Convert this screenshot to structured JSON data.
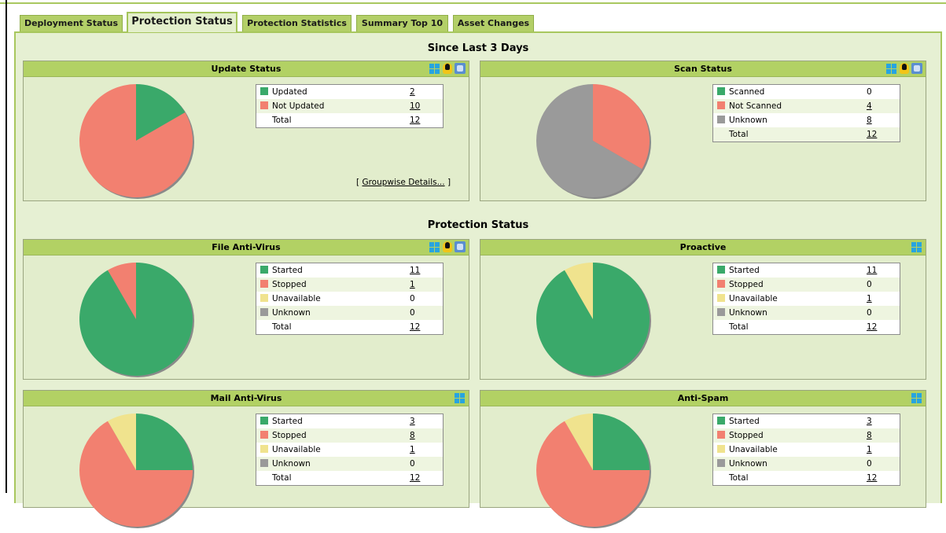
{
  "tabs": [
    {
      "label": "Deployment Status"
    },
    {
      "label": "Protection Status"
    },
    {
      "label": "Protection Statistics"
    },
    {
      "label": "Summary Top 10"
    },
    {
      "label": "Asset Changes"
    }
  ],
  "sections": {
    "since": "Since Last 3 Days",
    "protection": "Protection Status"
  },
  "colors": {
    "green": "#3aa96a",
    "red": "#f28070",
    "yellow": "#f0e38e",
    "gray": "#9a9a9a"
  },
  "panels": {
    "update": {
      "title": "Update Status",
      "icons": [
        "windows-icon",
        "linux-icon",
        "mac-icon"
      ],
      "rows": [
        {
          "label": "Updated",
          "value": "2",
          "link": true,
          "color": "green"
        },
        {
          "label": "Not Updated",
          "value": "10",
          "link": true,
          "color": "red"
        }
      ],
      "total_label": "Total",
      "total_value": "12",
      "details": "Groupwise Details...",
      "details_open": "[",
      "details_close": "]"
    },
    "scan": {
      "title": "Scan Status",
      "icons": [
        "windows-icon",
        "linux-icon",
        "mac-icon"
      ],
      "rows": [
        {
          "label": "Scanned",
          "value": "0",
          "link": false,
          "color": "green"
        },
        {
          "label": "Not Scanned",
          "value": "4",
          "link": true,
          "color": "red"
        },
        {
          "label": "Unknown",
          "value": "8",
          "link": true,
          "color": "gray"
        }
      ],
      "total_label": "Total",
      "total_value": "12"
    },
    "fav": {
      "title": "File Anti-Virus",
      "icons": [
        "windows-icon",
        "linux-icon",
        "mac-icon"
      ],
      "rows": [
        {
          "label": "Started",
          "value": "11",
          "link": true,
          "color": "green"
        },
        {
          "label": "Stopped",
          "value": "1",
          "link": true,
          "color": "red"
        },
        {
          "label": "Unavailable",
          "value": "0",
          "link": false,
          "color": "yellow"
        },
        {
          "label": "Unknown",
          "value": "0",
          "link": false,
          "color": "gray"
        }
      ],
      "total_label": "Total",
      "total_value": "12"
    },
    "proactive": {
      "title": "Proactive",
      "icons": [
        "windows-icon"
      ],
      "rows": [
        {
          "label": "Started",
          "value": "11",
          "link": true,
          "color": "green"
        },
        {
          "label": "Stopped",
          "value": "0",
          "link": false,
          "color": "red"
        },
        {
          "label": "Unavailable",
          "value": "1",
          "link": true,
          "color": "yellow"
        },
        {
          "label": "Unknown",
          "value": "0",
          "link": false,
          "color": "gray"
        }
      ],
      "total_label": "Total",
      "total_value": "12"
    },
    "mail": {
      "title": "Mail Anti-Virus",
      "icons": [
        "windows-icon"
      ],
      "rows": [
        {
          "label": "Started",
          "value": "3",
          "link": true,
          "color": "green"
        },
        {
          "label": "Stopped",
          "value": "8",
          "link": true,
          "color": "red"
        },
        {
          "label": "Unavailable",
          "value": "1",
          "link": true,
          "color": "yellow"
        },
        {
          "label": "Unknown",
          "value": "0",
          "link": false,
          "color": "gray"
        }
      ],
      "total_label": "Total",
      "total_value": "12"
    },
    "spam": {
      "title": "Anti-Spam",
      "icons": [
        "windows-icon"
      ],
      "rows": [
        {
          "label": "Started",
          "value": "3",
          "link": true,
          "color": "green"
        },
        {
          "label": "Stopped",
          "value": "8",
          "link": true,
          "color": "red"
        },
        {
          "label": "Unavailable",
          "value": "1",
          "link": true,
          "color": "yellow"
        },
        {
          "label": "Unknown",
          "value": "0",
          "link": false,
          "color": "gray"
        }
      ],
      "total_label": "Total",
      "total_value": "12"
    }
  },
  "chart_data": [
    {
      "type": "pie",
      "title": "Update Status",
      "labels": [
        "Updated",
        "Not Updated"
      ],
      "values": [
        2,
        10
      ]
    },
    {
      "type": "pie",
      "title": "Scan Status",
      "labels": [
        "Scanned",
        "Not Scanned",
        "Unknown"
      ],
      "values": [
        0,
        4,
        8
      ]
    },
    {
      "type": "pie",
      "title": "File Anti-Virus",
      "labels": [
        "Started",
        "Stopped",
        "Unavailable",
        "Unknown"
      ],
      "values": [
        11,
        1,
        0,
        0
      ]
    },
    {
      "type": "pie",
      "title": "Proactive",
      "labels": [
        "Started",
        "Stopped",
        "Unavailable",
        "Unknown"
      ],
      "values": [
        11,
        0,
        1,
        0
      ]
    },
    {
      "type": "pie",
      "title": "Mail Anti-Virus",
      "labels": [
        "Started",
        "Stopped",
        "Unavailable",
        "Unknown"
      ],
      "values": [
        3,
        8,
        1,
        0
      ]
    },
    {
      "type": "pie",
      "title": "Anti-Spam",
      "labels": [
        "Started",
        "Stopped",
        "Unavailable",
        "Unknown"
      ],
      "values": [
        3,
        8,
        1,
        0
      ]
    }
  ]
}
